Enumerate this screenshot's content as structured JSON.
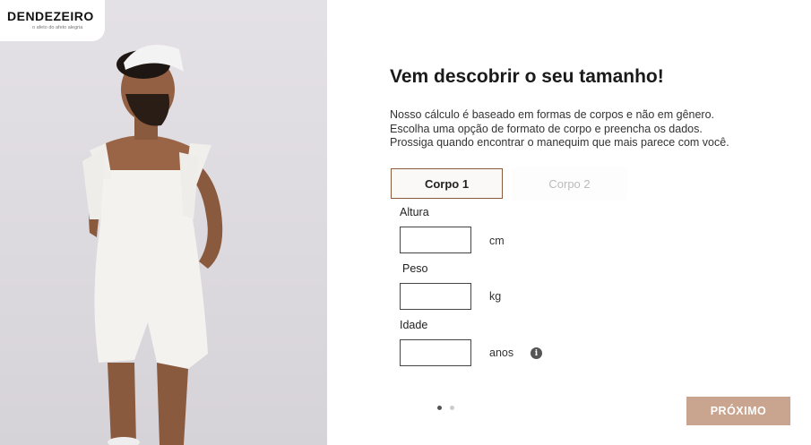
{
  "brand": {
    "logo_text": "DENDEZEIRO",
    "tagline": "o afeto do afeto alegria"
  },
  "main": {
    "title": "Vem descobrir o seu tamanho!",
    "description_lines": [
      "Nosso cálculo é baseado em formas de corpos e não em gênero.",
      "Escolha uma opção de formato de corpo e preencha os dados.",
      "Prossiga quando encontrar o manequim que mais parece com você."
    ]
  },
  "tabs": [
    {
      "label": "Corpo 1",
      "active": true
    },
    {
      "label": "Corpo 2",
      "active": false
    }
  ],
  "form": {
    "height": {
      "label": "Altura",
      "value": "",
      "unit": "cm"
    },
    "weight": {
      "label": "Peso",
      "value": "",
      "unit": "kg"
    },
    "age": {
      "label": "Idade",
      "value": "",
      "unit": "anos",
      "info_icon": "info-icon"
    }
  },
  "pagination": {
    "total": 2,
    "current": 1
  },
  "next_button": {
    "label": "PRÓXIMO"
  },
  "colors": {
    "accent_border": "#8b5a3c",
    "button_bg": "#c9a48e"
  }
}
